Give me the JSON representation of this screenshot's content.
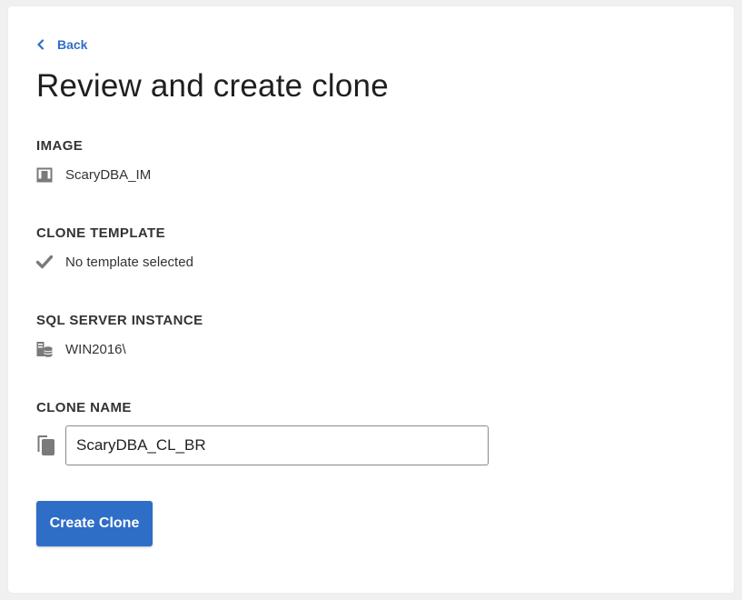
{
  "nav": {
    "back_label": "Back"
  },
  "page": {
    "title": "Review and create clone"
  },
  "image": {
    "label": "IMAGE",
    "value": "ScaryDBA_IM",
    "icon": "image-icon"
  },
  "clone_template": {
    "label": "CLONE TEMPLATE",
    "value": "No template selected",
    "icon": "checkmark-icon"
  },
  "sql_server_instance": {
    "label": "SQL SERVER INSTANCE",
    "value": "WIN2016\\",
    "icon": "database-server-icon"
  },
  "clone_name": {
    "label": "CLONE NAME",
    "value": "ScaryDBA_CL_BR",
    "icon": "copy-icon"
  },
  "actions": {
    "create_label": "Create Clone"
  },
  "colors": {
    "accent": "#2f6ec6",
    "icon_gray": "#7a7a7a",
    "background": "#f0f0f0"
  }
}
